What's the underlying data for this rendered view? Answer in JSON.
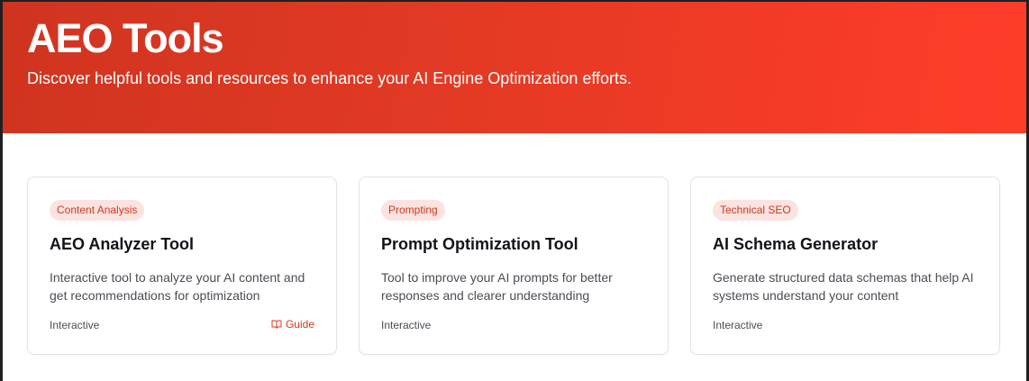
{
  "header": {
    "title": "AEO Tools",
    "subtitle": "Discover helpful tools and resources to enhance your AI Engine Optimization efforts."
  },
  "cards": [
    {
      "badge": "Content Analysis",
      "title": "AEO Analyzer Tool",
      "description": "Interactive tool to analyze your AI content and get recommendations for optimization",
      "type": "Interactive",
      "guide_label": "Guide",
      "guide_icon": "book-open-icon"
    },
    {
      "badge": "Prompting",
      "title": "Prompt Optimization Tool",
      "description": "Tool to improve your AI prompts for better responses and clearer understanding",
      "type": "Interactive"
    },
    {
      "badge": "Technical SEO",
      "title": "AI Schema Generator",
      "description": "Generate structured data schemas that help AI systems understand your content",
      "type": "Interactive"
    }
  ],
  "colors": {
    "accent": "#e33a24",
    "badge_bg": "#fde3df",
    "badge_text": "#c83a24"
  }
}
